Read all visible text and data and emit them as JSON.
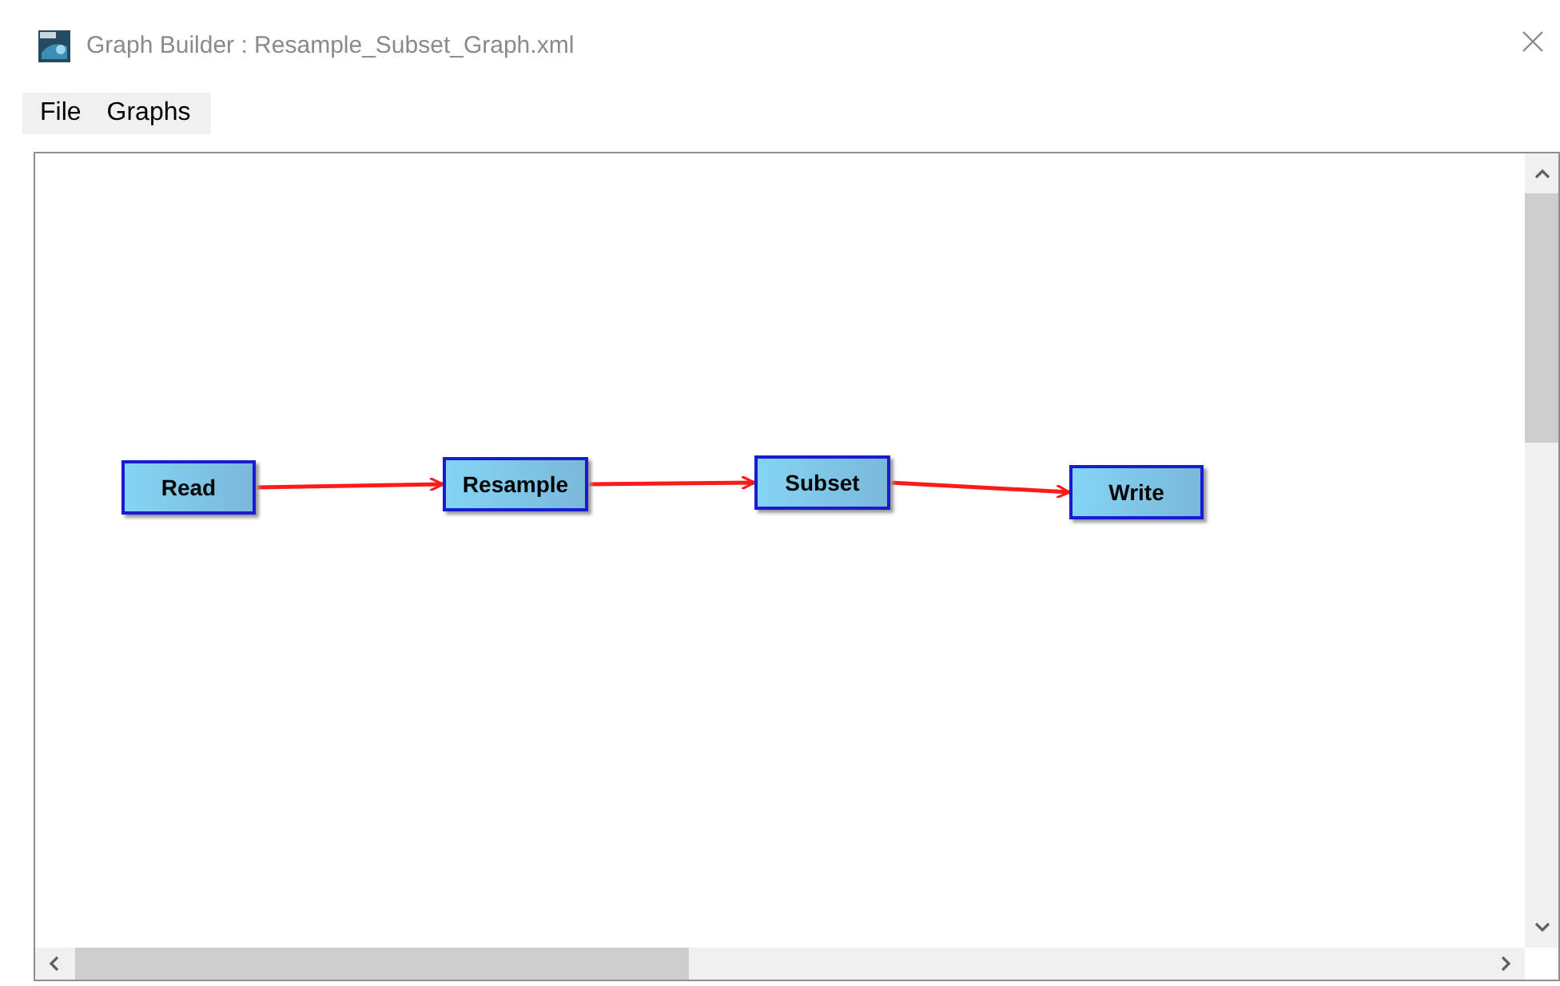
{
  "window": {
    "title": "Graph Builder : Resample_Subset_Graph.xml"
  },
  "menu": [
    {
      "label": "File"
    },
    {
      "label": "Graphs"
    }
  ],
  "graph": {
    "nodes": [
      {
        "label": "Read",
        "links_to_next": true
      },
      {
        "label": "Resample",
        "links_to_next": true
      },
      {
        "label": "Subset",
        "links_to_next": true
      },
      {
        "label": "Write",
        "links_to_next": false
      }
    ]
  }
}
